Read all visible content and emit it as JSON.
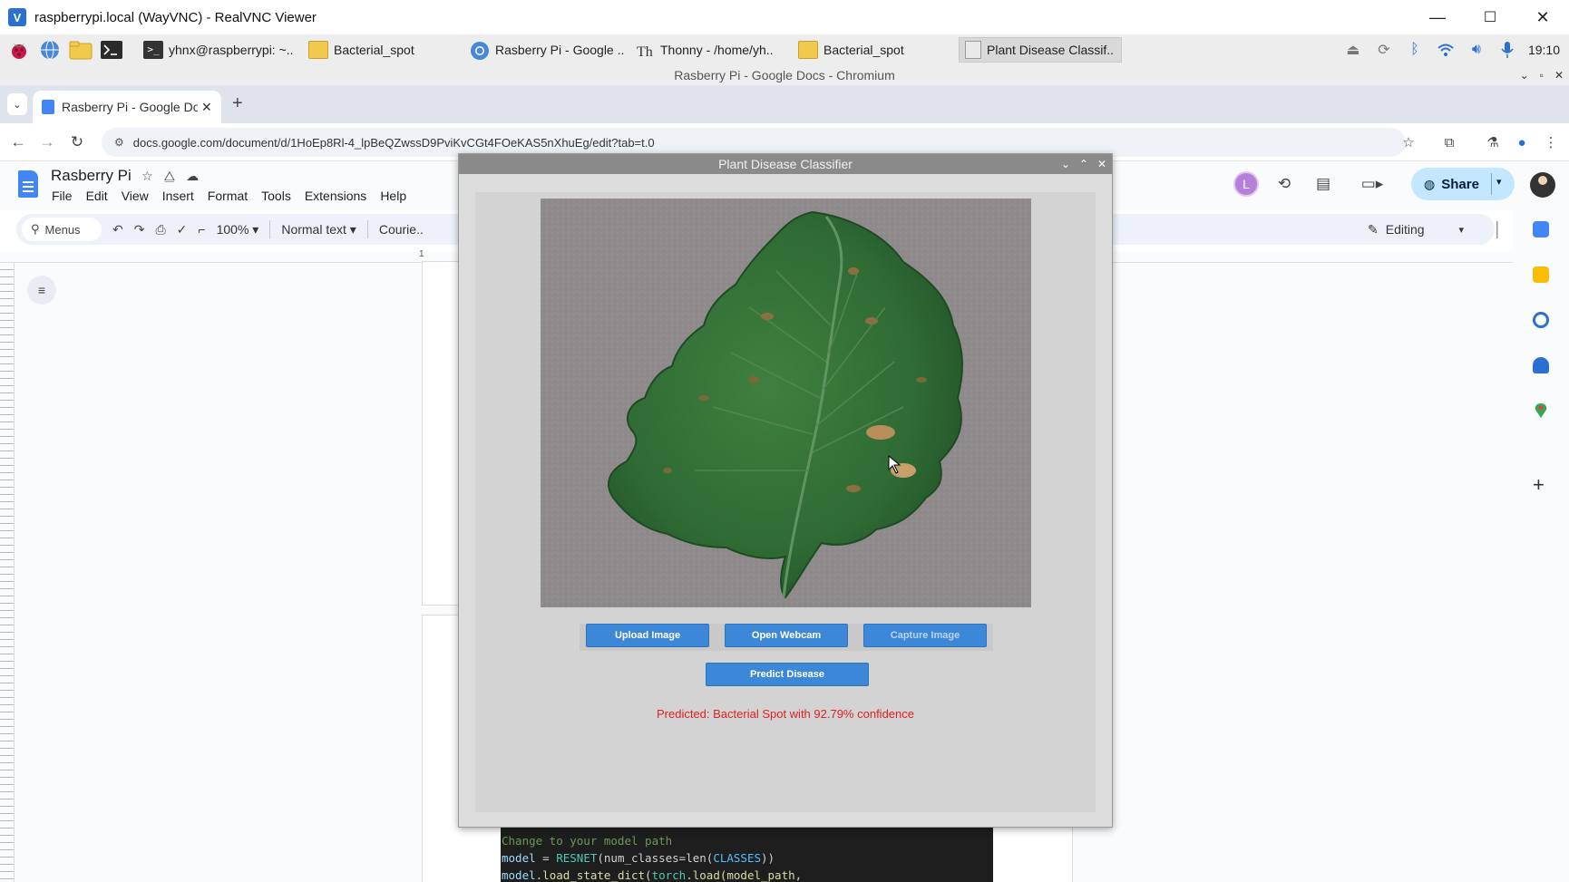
{
  "vnc": {
    "title": "raspberrypi.local (WayVNC) - RealVNC Viewer",
    "logo_text": "V",
    "minimize": "—",
    "maximize": "☐",
    "close": "✕"
  },
  "taskbar": {
    "tasks": [
      {
        "label": "yhnx@raspberrypi: ~..",
        "icon": "terminal-icon"
      },
      {
        "label": "Bacterial_spot",
        "icon": "folder-icon"
      },
      {
        "label": "Rasberry Pi - Google ..",
        "icon": "chromium-icon"
      },
      {
        "label": "Thonny  -  /home/yh..",
        "icon": "thonny-icon"
      },
      {
        "label": "Bacterial_spot",
        "icon": "folder-icon"
      },
      {
        "label": "Plant Disease Classif..",
        "icon": "window-icon"
      }
    ],
    "clock": "19:10"
  },
  "chromium": {
    "window_title": "Rasberry Pi - Google Docs - Chromium",
    "tab_title": "Rasberry Pi - Google Docs",
    "url": "docs.google.com/document/d/1HoEp8Rl-4_lpBeQZwssD9PviKvCGt4FOeKAS5nXhuEg/edit?tab=t.0"
  },
  "docs": {
    "title": "Rasberry Pi",
    "menus": [
      "File",
      "Edit",
      "View",
      "Insert",
      "Format",
      "Tools",
      "Extensions",
      "Help"
    ],
    "search_label": "Menus",
    "zoom": "100%",
    "style": "Normal text",
    "font": "Courie..",
    "mode": "Editing",
    "share": "Share",
    "avatar_letter": "L",
    "ruler_mark": "1"
  },
  "code": {
    "line1": "Change to your model path",
    "line2_var": "model",
    "line2_op": " = ",
    "line2_cls": "RESNET",
    "line2_rest": "(num_classes=len(",
    "line2_const": "CLASSES",
    "line2_end": "))",
    "line3_var": "model",
    "line3_fn": ".load_state_dict(",
    "line3_mod": "torch",
    "line3_rest": ".load(model_path,"
  },
  "classifier": {
    "window_title": "Plant Disease Classifier",
    "upload_btn": "Upload Image",
    "webcam_btn": "Open Webcam",
    "capture_btn": "Capture Image",
    "predict_btn": "Predict Disease",
    "prediction": "Predicted: Bacterial Spot with 92.79% confidence"
  },
  "colors": {
    "share_bg": "#c2e7ff",
    "classifier_button": "#3d87d8",
    "prediction_text": "#e02020"
  }
}
